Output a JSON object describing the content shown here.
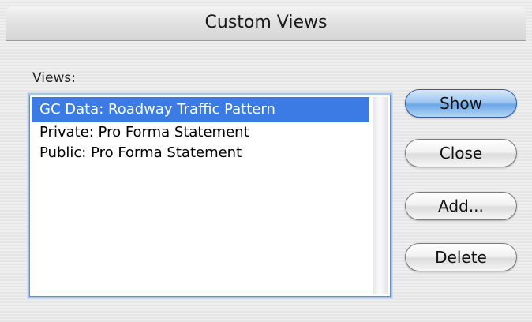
{
  "window": {
    "title": "Custom Views"
  },
  "views": {
    "label": "Views:",
    "items": [
      {
        "label": "GC Data: Roadway Traffic Pattern",
        "selected": true
      },
      {
        "label": "Private: Pro Forma Statement",
        "selected": false
      },
      {
        "label": "Public: Pro Forma Statement",
        "selected": false
      }
    ]
  },
  "buttons": {
    "show": "Show",
    "close": "Close",
    "add": "Add...",
    "delete": "Delete"
  },
  "colors": {
    "selection": "#3c7be4",
    "focus_ring": "#a9c4e8",
    "default_button": "#6aa6e6"
  }
}
